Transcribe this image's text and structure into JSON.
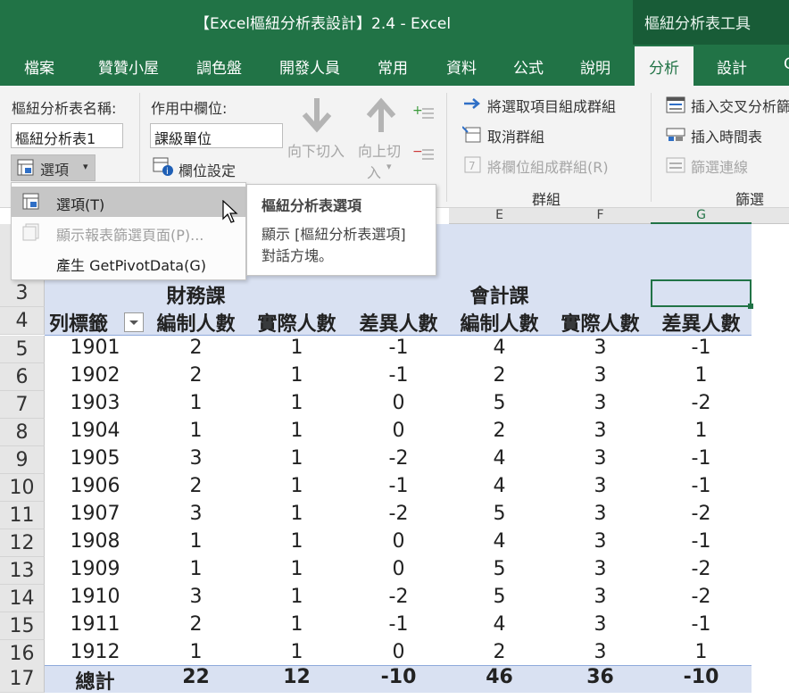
{
  "window": {
    "title": "【Excel樞紐分析表設計】2.4  -  Excel",
    "context_title": "樞紐分析表工具"
  },
  "tabs": [
    "檔案",
    "贊贊小屋",
    "調色盤",
    "開發人員",
    "常用",
    "資料",
    "公式",
    "說明",
    "分析",
    "設計",
    "Q"
  ],
  "active_tab": "分析",
  "ribbon": {
    "pivot_name_label": "樞紐分析表名稱:",
    "pivot_name_value": "樞紐分析表1",
    "options_button": "選項",
    "active_field_label": "作用中欄位:",
    "active_field_value": "課級單位",
    "field_settings": "欄位設定",
    "drill_down": "向下切入",
    "drill_up_line1": "向上切",
    "drill_up_line2": "入",
    "group_selection": "將選取項目組成群組",
    "ungroup": "取消群組",
    "group_field": "將欄位組成群組(R)",
    "group_label": "群組",
    "insert_slicer": "插入交叉分析篩",
    "insert_timeline": "插入時間表",
    "filter_connections": "篩選連線",
    "filter_label": "篩選"
  },
  "menu": {
    "items": [
      {
        "label": "選項(T)",
        "highlighted": true,
        "disabled": false
      },
      {
        "label": "顯示報表篩選頁面(P)...",
        "highlighted": false,
        "disabled": true
      },
      {
        "label": "產生 GetPivotData(G)",
        "highlighted": false,
        "disabled": false
      }
    ]
  },
  "tooltip": {
    "title": "樞紐分析表選項",
    "body": "顯示 [樞紐分析表選項] 對話方塊。"
  },
  "columns": [
    "E",
    "F",
    "G"
  ],
  "sheet": {
    "group_headers": [
      "財務課",
      "會計課"
    ],
    "row_label_header": "列標籤",
    "headers": [
      "編制人數",
      "實際人數",
      "差異人數",
      "編制人數",
      "實際人數",
      "差異人數"
    ],
    "rows": [
      {
        "num": "5",
        "cells": [
          "1901",
          "2",
          "1",
          "-1",
          "4",
          "3",
          "-1"
        ]
      },
      {
        "num": "6",
        "cells": [
          "1902",
          "2",
          "1",
          "-1",
          "2",
          "3",
          "1"
        ]
      },
      {
        "num": "7",
        "cells": [
          "1903",
          "1",
          "1",
          "0",
          "5",
          "3",
          "-2"
        ]
      },
      {
        "num": "8",
        "cells": [
          "1904",
          "1",
          "1",
          "0",
          "2",
          "3",
          "1"
        ]
      },
      {
        "num": "9",
        "cells": [
          "1905",
          "3",
          "1",
          "-2",
          "4",
          "3",
          "-1"
        ]
      },
      {
        "num": "10",
        "cells": [
          "1906",
          "2",
          "1",
          "-1",
          "4",
          "3",
          "-1"
        ]
      },
      {
        "num": "11",
        "cells": [
          "1907",
          "3",
          "1",
          "-2",
          "5",
          "3",
          "-2"
        ]
      },
      {
        "num": "12",
        "cells": [
          "1908",
          "1",
          "1",
          "0",
          "4",
          "3",
          "-1"
        ]
      },
      {
        "num": "13",
        "cells": [
          "1909",
          "1",
          "1",
          "0",
          "5",
          "3",
          "-2"
        ]
      },
      {
        "num": "14",
        "cells": [
          "1910",
          "3",
          "1",
          "-2",
          "5",
          "3",
          "-2"
        ]
      },
      {
        "num": "15",
        "cells": [
          "1911",
          "2",
          "1",
          "-1",
          "4",
          "3",
          "-1"
        ]
      },
      {
        "num": "16",
        "cells": [
          "1912",
          "1",
          "1",
          "0",
          "2",
          "3",
          "1"
        ]
      }
    ],
    "total": {
      "num": "17",
      "cells": [
        "總計",
        "22",
        "12",
        "-10",
        "46",
        "36",
        "-10"
      ]
    },
    "row_numbers": [
      "3",
      "4"
    ]
  },
  "colors": {
    "excel_green": "#217346",
    "context_green": "#185c37",
    "pivot_band": "#d9e1f2"
  }
}
